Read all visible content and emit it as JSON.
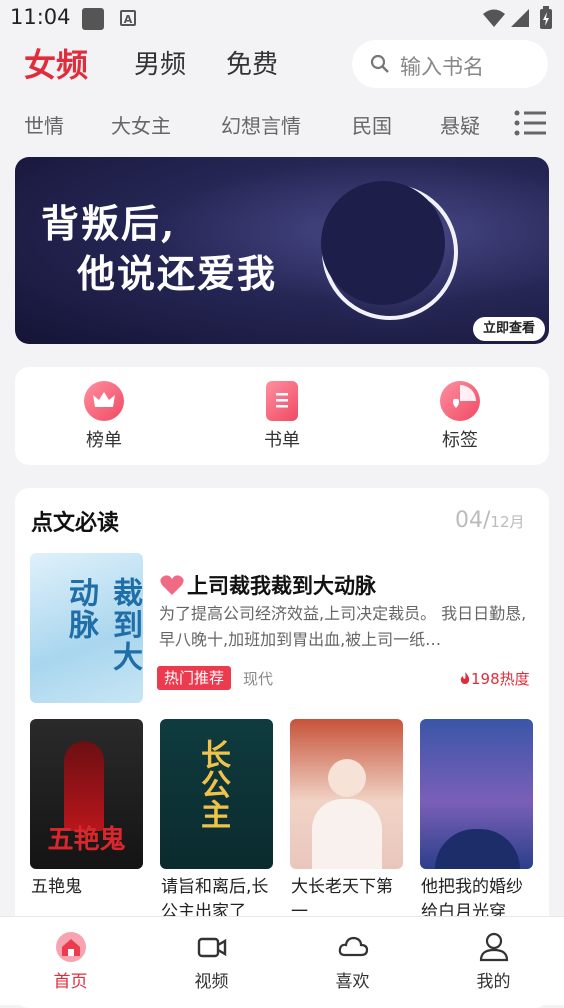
{
  "status_bar": {
    "time": "11:04"
  },
  "top_tabs": [
    {
      "label": "女频",
      "active": true
    },
    {
      "label": "男频",
      "active": false
    },
    {
      "label": "免费",
      "active": false
    }
  ],
  "search": {
    "placeholder": "输入书名"
  },
  "categories": [
    "世情",
    "大女主",
    "幻想言情",
    "民国",
    "悬疑"
  ],
  "banner": {
    "line1": "背叛后,",
    "line2": "他说还爱我",
    "button": "立即查看"
  },
  "quick_menu": [
    {
      "label": "榜单",
      "icon": "crown-icon"
    },
    {
      "label": "书单",
      "icon": "booklist-icon"
    },
    {
      "label": "标签",
      "icon": "tag-pie-icon"
    }
  ],
  "section": {
    "title": "点文必读",
    "date_day": "04/",
    "date_month": "12月",
    "featured": {
      "title": "上司裁我裁到大动脉",
      "cover_text": "裁到大动脉",
      "description": "为了提高公司经济效益,上司决定裁员。 我日日勤恳,早八晚十,加班加到胃出血,被上司一纸…",
      "badge": "热门推荐",
      "genre": "现代",
      "heat": "198热度"
    },
    "books": [
      {
        "title": "五艳鬼",
        "cover_text": "五艳鬼"
      },
      {
        "title": "请旨和离后,长公主出家了",
        "cover_text": "长公主"
      },
      {
        "title": "大长老天下第一",
        "cover_text": ""
      },
      {
        "title": "他把我的婚纱给白月光穿",
        "cover_text": ""
      }
    ]
  },
  "bottom_nav": [
    {
      "label": "首页",
      "icon": "home-icon",
      "active": true
    },
    {
      "label": "视频",
      "icon": "video-icon",
      "active": false
    },
    {
      "label": "喜欢",
      "icon": "cloud-icon",
      "active": false
    },
    {
      "label": "我的",
      "icon": "user-icon",
      "active": false
    }
  ],
  "colors": {
    "accent": "#e02d3c",
    "background": "#f3f3f5"
  }
}
